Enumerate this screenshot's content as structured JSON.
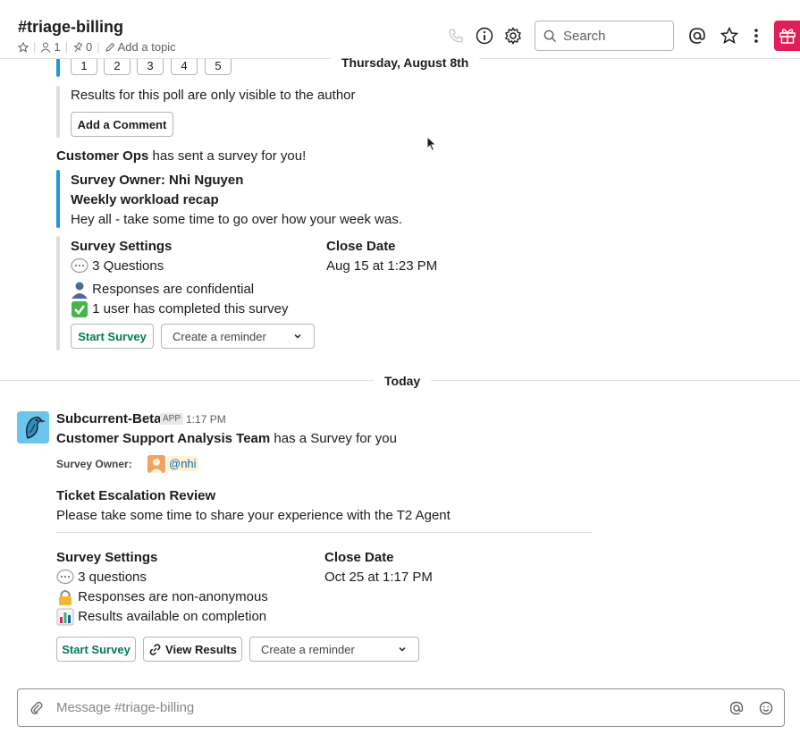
{
  "header": {
    "channel_name": "#triage-billing",
    "members_count": "1",
    "pins_count": "0",
    "add_topic": "Add a topic",
    "search_placeholder": "Search"
  },
  "earlier": {
    "date_label": "Thursday, August 8th",
    "poll_numbers": [
      "1",
      "2",
      "3",
      "4",
      "5"
    ],
    "poll_notice": "Results for this poll are only visible to the author",
    "add_comment": "Add a Comment",
    "sender": "Customer Ops",
    "sender_suffix": "has sent a survey for you!",
    "survey_owner": "Survey Owner: Nhi Nguyen",
    "survey_title": "Weekly workload recap",
    "survey_desc": "Hey all - take some time to go over how your week was.",
    "settings_title": "Survey Settings",
    "questions": "3 Questions",
    "confidential": "Responses are confidential",
    "completed": "1 user has completed this survey",
    "close_date_label": "Close Date",
    "close_date": "Aug 15 at 1:23 PM",
    "start_survey": "Start Survey",
    "reminder": "Create a reminder"
  },
  "today": {
    "date_label": "Today",
    "app_name": "Subcurrent-Beta",
    "app_badge": "APP",
    "time": "1:17 PM",
    "team": "Customer Support Analysis Team",
    "team_suffix": "has a Survey for you",
    "owner_label": "Survey Owner:",
    "owner_mention": "@nhi",
    "title": "Ticket Escalation Review",
    "desc": "Please take some time to share your experience with the T2 Agent",
    "settings_title": "Survey Settings",
    "questions": "3 questions",
    "anonymity": "Responses are non-anonymous",
    "results": "Results available on completion",
    "close_date_label": "Close Date",
    "close_date": "Oct 25 at 1:17 PM",
    "start_survey": "Start Survey",
    "view_results": "View Results",
    "reminder": "Create a reminder"
  },
  "composer": {
    "placeholder": "Message #triage-billing"
  },
  "colors": {
    "accent_blue": "#1d9bd1",
    "start_green": "#007a5a",
    "gift_red": "#e01e5a"
  }
}
